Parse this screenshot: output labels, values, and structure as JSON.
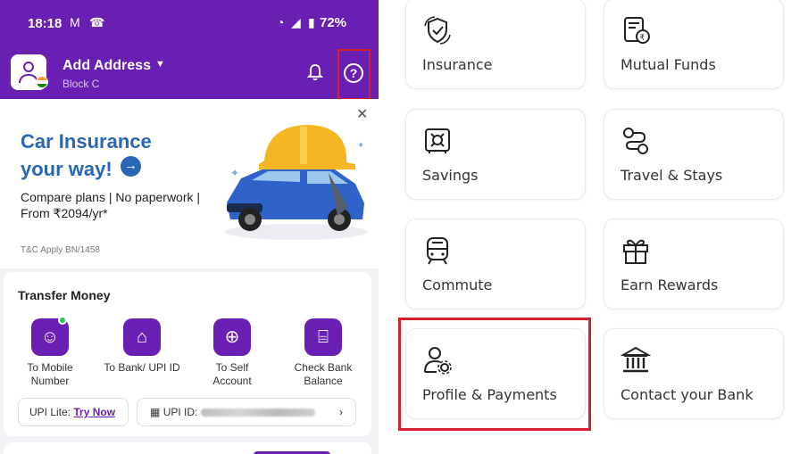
{
  "status_bar": {
    "time": "18:18",
    "battery": "72%"
  },
  "header": {
    "address_title": "Add Address",
    "address_subtitle": "Block C"
  },
  "banner": {
    "title_line1": "Car Insurance",
    "title_line2": "your way!",
    "desc_line1": "Compare plans | No paperwork |",
    "desc_line2": "From ₹2094/yr*",
    "tnc": "T&C Apply BN/1458"
  },
  "transfer": {
    "title": "Transfer Money",
    "items": [
      {
        "line1": "To Mobile",
        "line2": "Number"
      },
      {
        "line1": "To Bank/ UPI ID",
        "line2": ""
      },
      {
        "line1": "To Self",
        "line2": "Account"
      },
      {
        "line1": "Check Bank",
        "line2": "Balance"
      }
    ],
    "upi_lite_label": "UPI Lite:",
    "upi_lite_link": "Try Now",
    "upi_id_label": "UPI ID:"
  },
  "tiles": [
    {
      "label": "Insurance",
      "icon": "insurance-icon"
    },
    {
      "label": "Mutual Funds",
      "icon": "mutual-funds-icon"
    },
    {
      "label": "Savings",
      "icon": "savings-icon"
    },
    {
      "label": "Travel & Stays",
      "icon": "travel-icon"
    },
    {
      "label": "Commute",
      "icon": "commute-icon"
    },
    {
      "label": "Earn Rewards",
      "icon": "gift-icon"
    },
    {
      "label": "Profile & Payments",
      "icon": "profile-settings-icon"
    },
    {
      "label": "Contact your Bank",
      "icon": "bank-icon"
    }
  ],
  "colors": {
    "brand_purple": "#6a1fb3",
    "highlight_red": "#d3202a",
    "banner_blue": "#2a66b6",
    "online_green": "#2ec55e"
  }
}
